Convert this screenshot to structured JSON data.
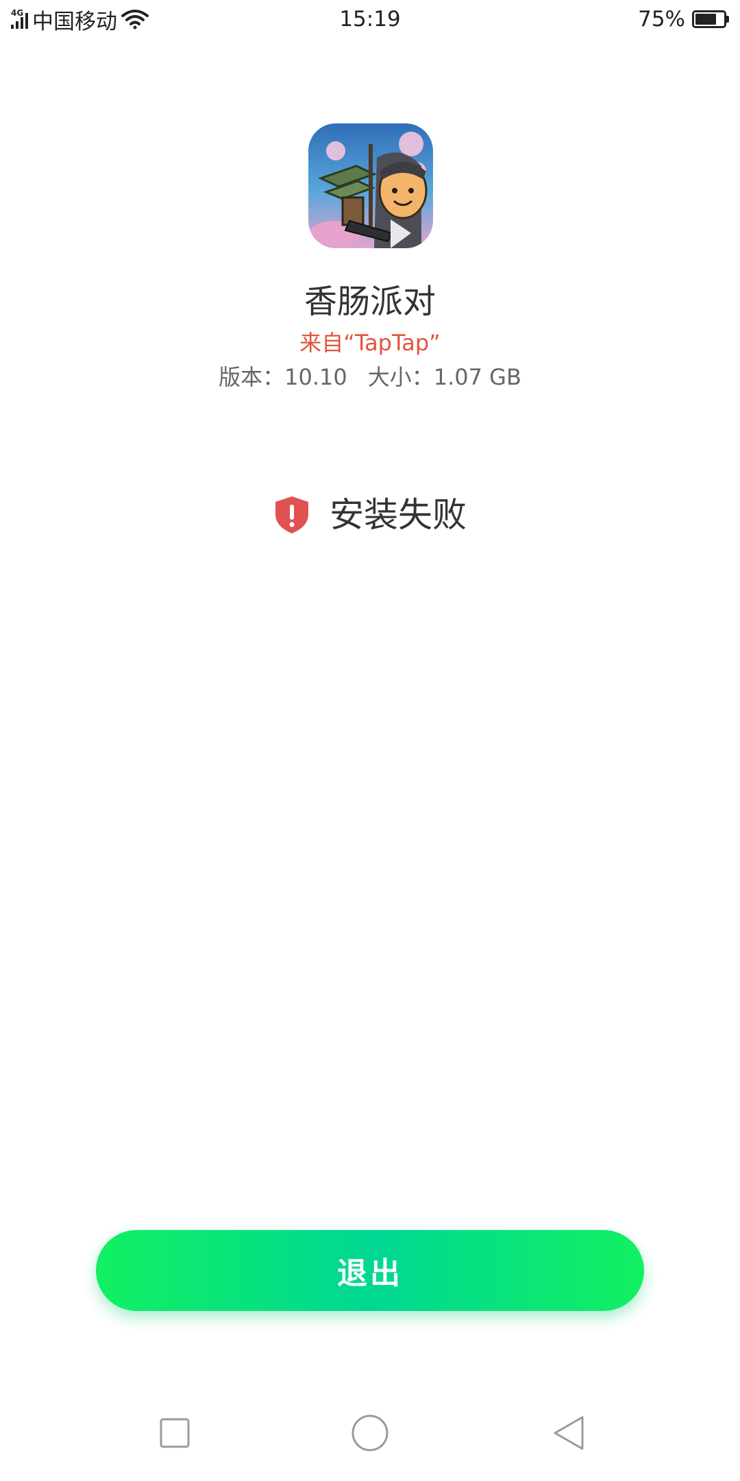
{
  "status_bar": {
    "network_tag": "4G",
    "carrier": "中国移动",
    "time": "15:19",
    "battery_percent": "75%",
    "battery_level": 0.75
  },
  "app": {
    "name": "香肠派对",
    "source": "来自“TapTap”",
    "version": "版本：10.10",
    "size": "大小：1.07 GB"
  },
  "install": {
    "status": "安装失败",
    "icon": "shield-exclamation-icon",
    "accent_color": "#e05252"
  },
  "actions": {
    "exit_label": "退出",
    "button_color": "#00e676"
  },
  "nav_bar": {
    "recent": "square-icon",
    "home": "circle-icon",
    "back": "triangle-back-icon"
  }
}
